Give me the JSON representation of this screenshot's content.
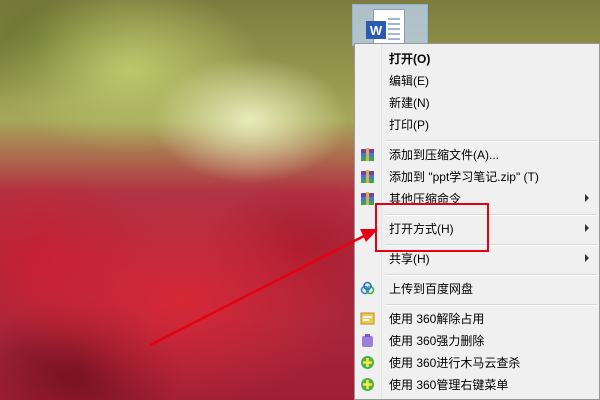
{
  "desktop": {
    "file_icon_letter": "W",
    "file_icon_name": "word-document-icon"
  },
  "context_menu": {
    "items": [
      {
        "label": "打开(O)",
        "bold": true
      },
      {
        "label": "编辑(E)"
      },
      {
        "label": "新建(N)"
      },
      {
        "label": "打印(P)"
      },
      {
        "label": "添加到压缩文件(A)...",
        "icon": "winrar-archive-icon"
      },
      {
        "label": "添加到 \"ppt学习笔记.zip\" (T)",
        "icon": "winrar-archive-icon"
      },
      {
        "label": "其他压缩命令",
        "icon": "winrar-archive-icon",
        "submenu": true
      },
      {
        "label": "打开方式(H)",
        "submenu": true
      },
      {
        "label": "共享(H)",
        "submenu": true
      },
      {
        "label": "上传到百度网盘",
        "icon": "baidu-netdisk-icon"
      },
      {
        "label": "使用 360解除占用",
        "icon": "360-unlock-icon"
      },
      {
        "label": "使用 360强力删除",
        "icon": "360-shred-icon"
      },
      {
        "label": "使用 360进行木马云查杀",
        "icon": "360-scan-icon"
      },
      {
        "label": "使用 360管理右键菜单",
        "icon": "360-manage-icon"
      }
    ]
  },
  "annotation": {
    "highlight_color": "#e60012",
    "arrow_color": "#e60012"
  }
}
